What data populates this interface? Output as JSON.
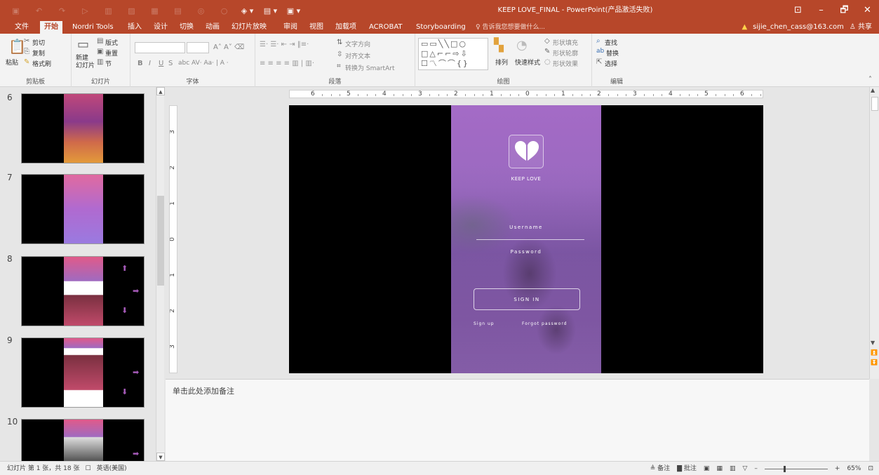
{
  "window": {
    "title": "KEEP LOVE_FINAL - PowerPoint(产品激活失败)",
    "controls": {
      "options": "⊡",
      "minimize": "–",
      "restore": "🗗",
      "close": "✕"
    },
    "accent_color": "#b7472a"
  },
  "quick_access": [
    "save-icon",
    "undo-icon",
    "redo-icon",
    "start-slideshow-icon",
    "chart-icon",
    "picture-icon",
    "table-icon",
    "grid-icon",
    "shape-icon",
    "more-icon",
    "layout-icon",
    "arrange-icon",
    "customize-icon"
  ],
  "tabs": [
    {
      "label": "文件"
    },
    {
      "label": "开始"
    },
    {
      "label": "Nordri Tools"
    },
    {
      "label": "插入"
    },
    {
      "label": "设计"
    },
    {
      "label": "切换"
    },
    {
      "label": "动画"
    },
    {
      "label": "幻灯片放映"
    },
    {
      "label": "审阅"
    },
    {
      "label": "视图"
    },
    {
      "label": "加载项"
    },
    {
      "label": "ACROBAT"
    },
    {
      "label": "Storyboarding"
    }
  ],
  "tell_me": "♀ 告诉我您想要做什么...",
  "account": {
    "email": "sijie_chen_cass@163.com",
    "share": "共享"
  },
  "ribbon": {
    "clipboard": {
      "paste": "粘贴",
      "cut": "剪切",
      "copy": "复制",
      "format_painter": "格式刷",
      "label": "剪贴板"
    },
    "slides": {
      "new_slide": "新建\n幻灯片",
      "layout": "版式",
      "reset": "重置",
      "section": "节",
      "label": "幻灯片"
    },
    "font": {
      "label": "字体",
      "bold": "B",
      "italic": "I",
      "underline": "U",
      "strike": "S"
    },
    "paragraph": {
      "text_direction": "文字方向",
      "align_text": "对齐文本",
      "convert_smartart": "转换为 SmartArt",
      "label": "段落"
    },
    "drawing": {
      "arrange": "排列",
      "quick_styles": "快速样式",
      "shape_fill": "形状填充",
      "shape_outline": "形状轮廓",
      "shape_effects": "形状效果",
      "label": "绘图"
    },
    "editing": {
      "find": "查找",
      "replace": "替换",
      "select": "选择",
      "label": "编辑"
    }
  },
  "thumbnails": [
    {
      "number": "6"
    },
    {
      "number": "7"
    },
    {
      "number": "8"
    },
    {
      "number": "9"
    },
    {
      "number": "10"
    }
  ],
  "ruler": {
    "h_ticks": [
      "6",
      "5",
      "4",
      "3",
      "2",
      "1",
      "0",
      "1",
      "2",
      "3",
      "4",
      "5",
      "6"
    ],
    "v_ticks": [
      "3",
      "2",
      "1",
      "0",
      "1",
      "2",
      "3"
    ]
  },
  "slide": {
    "app_name": "KEEP LOVE",
    "username_label": "Username",
    "password_label": "Password",
    "signin_label": "SIGN IN",
    "signup_link": "Sign up",
    "forgot_link": "Forgot password"
  },
  "notes_placeholder": "单击此处添加备注",
  "status": {
    "slide_info": "幻灯片 第 1 张，共 18 张",
    "language": "英语(美国)",
    "notes": "≜ 备注",
    "comments": "批注",
    "zoom": "65%",
    "zoom_level": 0.65
  }
}
